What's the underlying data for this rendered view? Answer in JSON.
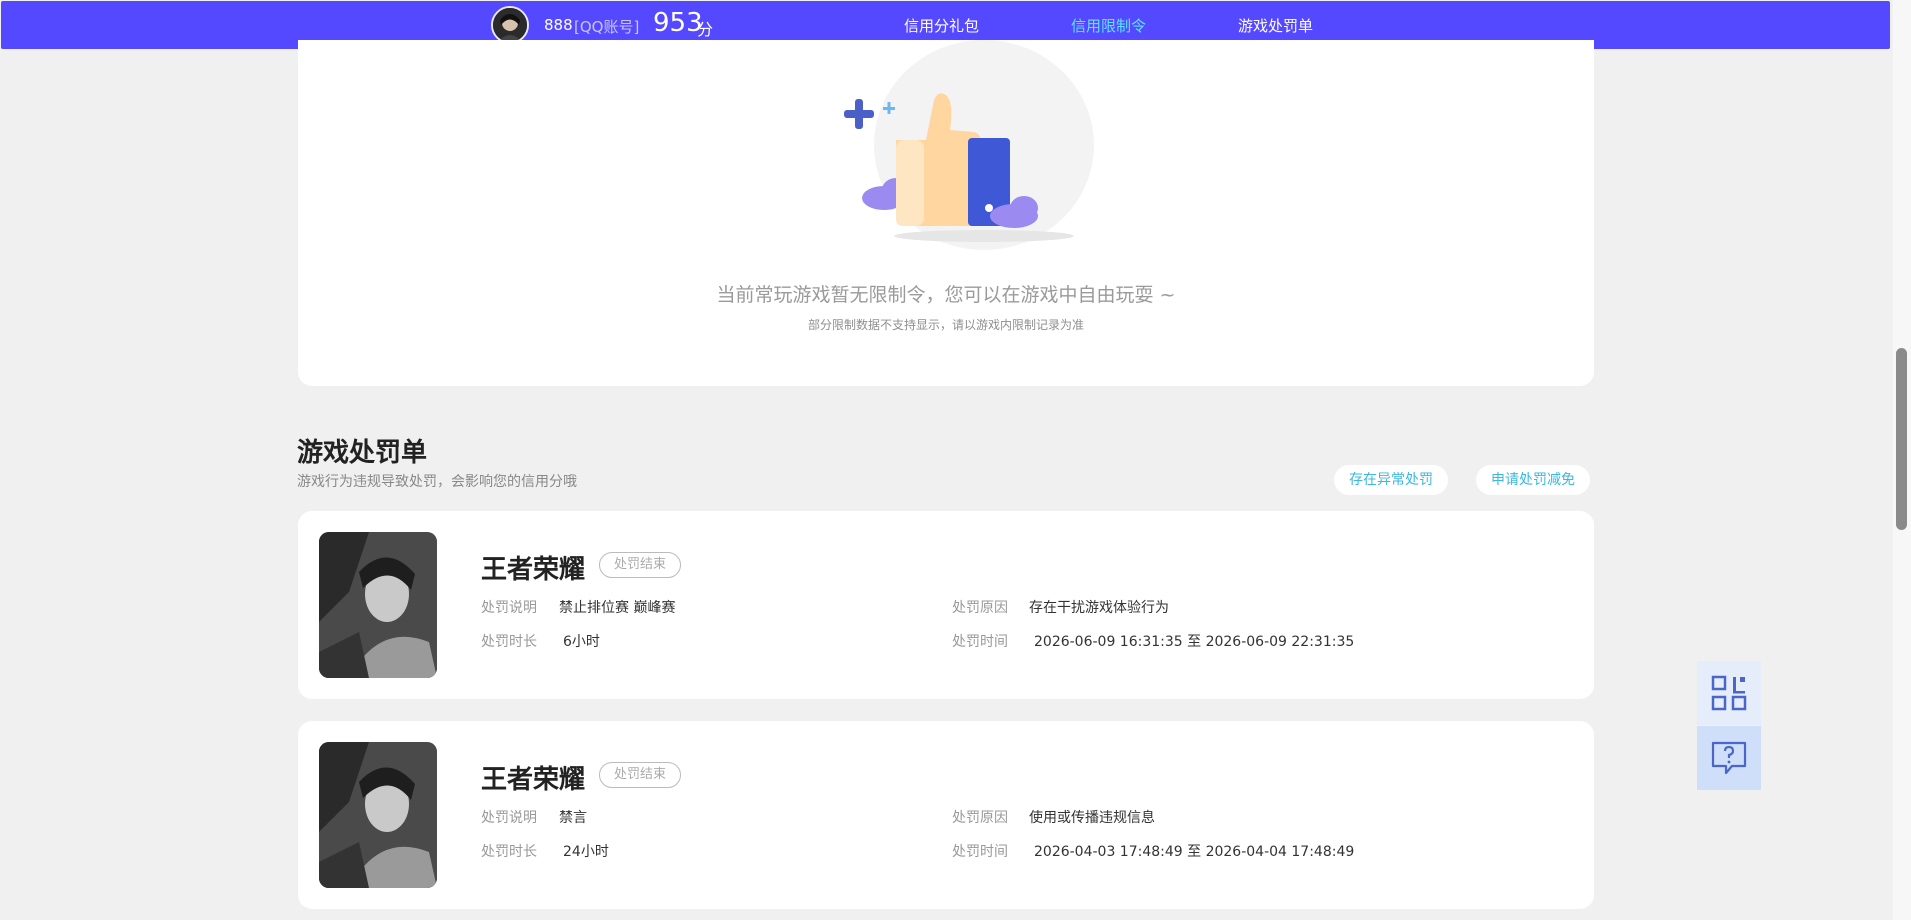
{
  "user": {
    "name": "888",
    "account_type": "[QQ账号]",
    "score": "953",
    "score_unit": "分"
  },
  "nav": {
    "items": [
      {
        "label": "信用分礼包"
      },
      {
        "label": "信用限制令"
      },
      {
        "label": "游戏处罚单"
      }
    ],
    "active": "信用限制令"
  },
  "restriction": {
    "empty_message": "当前常玩游戏暂无限制令，您可以在游戏中自由玩耍 ~",
    "note": "部分限制数据不支持显示，请以游戏内限制记录为准"
  },
  "penalty_section": {
    "title": "游戏处罚单",
    "subtitle": "游戏行为违规导致处罚，会影响您的信用分哦",
    "report_abnormal_label": "存在异常处罚",
    "apply_reduction_label": "申请处罚减免"
  },
  "labels": {
    "desc": "处罚说明",
    "duration": "处罚时长",
    "reason": "处罚原因",
    "time": "处罚时间"
  },
  "penalties": [
    {
      "game": "王者荣耀",
      "status": "处罚结束",
      "desc": "禁止排位赛 巅峰赛",
      "duration": "6小时",
      "reason": "存在干扰游戏体验行为",
      "time": "2026-06-09 16:31:35 至 2026-06-09 22:31:35"
    },
    {
      "game": "王者荣耀",
      "status": "处罚结束",
      "desc": "禁言",
      "duration": "24小时",
      "reason": "使用或传播违规信息",
      "time": "2026-04-03 17:48:49 至 2026-04-04 17:48:49"
    }
  ],
  "colors": {
    "topbar": "#5549ff",
    "active_nav": "#5ce6ff",
    "pill_text": "#3bb8e0"
  }
}
